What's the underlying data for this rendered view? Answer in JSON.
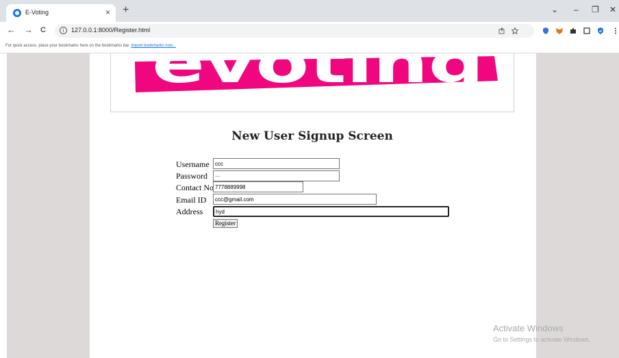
{
  "browser": {
    "tab_title": "E-Voting",
    "tab_close": "×",
    "new_tab": "+",
    "url": "127.0.0.1:8000/Register.html",
    "bookmarks_prompt": "For quick access, place your bookmarks here on the bookmarks bar.",
    "bookmarks_link": "Import bookmarks now...",
    "window_controls": [
      "⌄",
      "–",
      "❐",
      "✕"
    ],
    "nav": {
      "back": "←",
      "forward": "→",
      "reload": "C",
      "info": "i"
    },
    "toolbar_icons": [
      "share-icon",
      "star-icon",
      "shield-extension-icon",
      "metamask-icon",
      "puzzle-extensions-icon",
      "sidepanel-icon",
      "profile-shield-icon",
      "menu-icon"
    ]
  },
  "page": {
    "logo_text": "evoting",
    "logo_color": "#f0077f",
    "heading": "New User Signup Screen",
    "form": {
      "username_label": "Username",
      "username_value": "ccc",
      "password_label": "Password",
      "password_value": "···",
      "contact_label": "Contact No",
      "contact_value": "7778889998",
      "email_label": "Email ID",
      "email_value": "ccc@gmail.com",
      "address_label": "Address",
      "address_value": "hyd",
      "submit_label": "Register"
    }
  },
  "watermark": {
    "line1": "Activate Windows",
    "line2": "Go to Settings to activate Windows."
  }
}
